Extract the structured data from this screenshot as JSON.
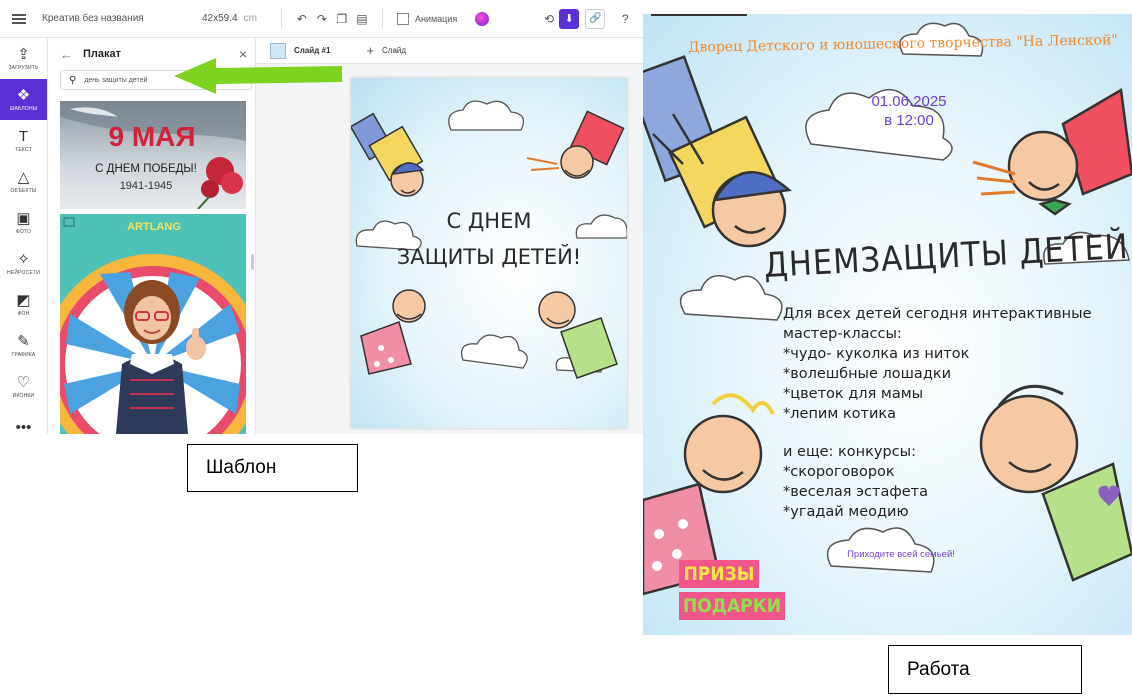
{
  "editor": {
    "doc_title": "Креатив без названия",
    "doc_size": "42x59.4",
    "doc_unit": "cm",
    "animation_label": "Анимация",
    "sidebar": [
      {
        "label": "ЗАГРУЗИТЬ",
        "icon": "upload-icon",
        "glyph": "⇪"
      },
      {
        "label": "ШАБЛОНЫ",
        "icon": "templates-icon",
        "glyph": "❖",
        "active": true
      },
      {
        "label": "ТЕКСТ",
        "icon": "text-icon",
        "glyph": "T"
      },
      {
        "label": "ОБЪЕКТЫ",
        "icon": "objects-icon",
        "glyph": "△"
      },
      {
        "label": "ФОТО",
        "icon": "photo-icon",
        "glyph": "▣"
      },
      {
        "label": "НЕЙРОСЕТИ",
        "icon": "magic-wand-icon",
        "glyph": "✧"
      },
      {
        "label": "ФОН",
        "icon": "background-icon",
        "glyph": "◩"
      },
      {
        "label": "ГРАФИКА",
        "icon": "pen-icon",
        "glyph": "✎"
      },
      {
        "label": "ИКОНКИ",
        "icon": "heart-icon",
        "glyph": "♡"
      },
      {
        "label": "",
        "icon": "more-icon",
        "glyph": "•••"
      }
    ],
    "panel": {
      "title": "Плакат",
      "search_value": "день защиты детей",
      "templates": [
        {
          "line1": "9 МАЯ",
          "line2": "С ДНЕМ ПОБЕДЫ!",
          "line3": "1941-1945"
        },
        {
          "brand": "ARTLANG"
        }
      ]
    },
    "slide_name": "Слайд #1",
    "add_slide_label": "Слайд",
    "canvas_text_line1": "С ДНЕМ",
    "canvas_text_line2": "ЗАЩИТЫ ДЕТЕЙ!",
    "accent_color": "#5b30d6",
    "arrow_color": "#7ed321"
  },
  "labels": {
    "template": "Шаблон",
    "work": "Работа"
  },
  "poster": {
    "organization": "Дворец Детского и юношеского творчества \"На Ленской\"",
    "date": "01.06.2025",
    "time": "в 12:00",
    "headline": "ДНЕМЗАЩИТЫ ДЕТЕЙ!",
    "info_lines": [
      "Для всех детей сегодня интерактивные",
      "мастер-классы:",
      "*чудо- куколка из ниток",
      "*волешбные лошадки",
      "*цветок для мамы",
      "*лепим котика"
    ],
    "extra_lines": [
      "и еще: конкурсы:",
      "*скороговорок",
      "*веселая эстафета",
      "*угадай меодию"
    ],
    "welcome": "Приходите всей семьей!",
    "prize1": "ПРИЗЫ",
    "prize2": "ПОДАРКИ"
  }
}
